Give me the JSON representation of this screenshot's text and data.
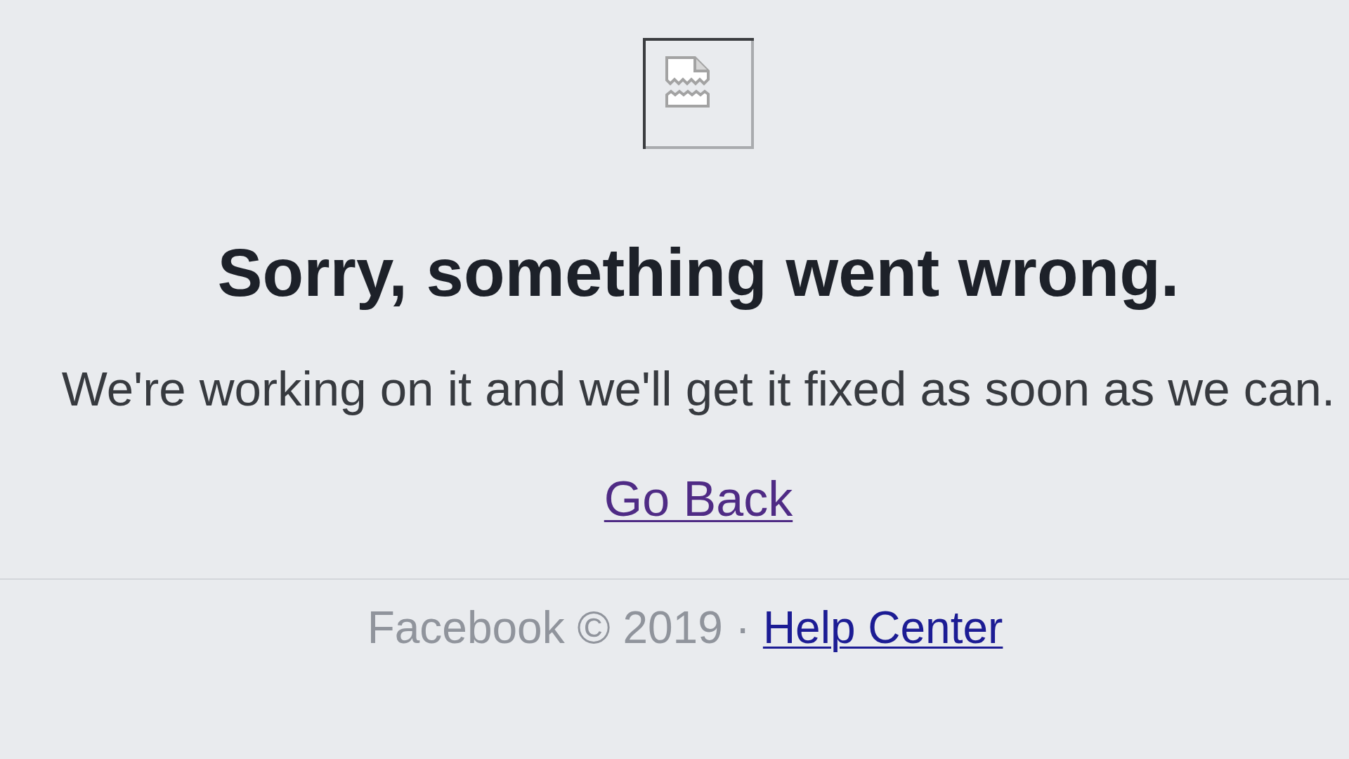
{
  "error": {
    "title": "Sorry, something went wrong.",
    "message": "We're working on it and we'll get it fixed as soon as we can.",
    "link": {
      "label": "Go Back",
      "visited": true
    }
  },
  "footer": {
    "copyright": "Facebook © 2019 ·",
    "link": {
      "label": "Help Center",
      "visited": false
    }
  }
}
